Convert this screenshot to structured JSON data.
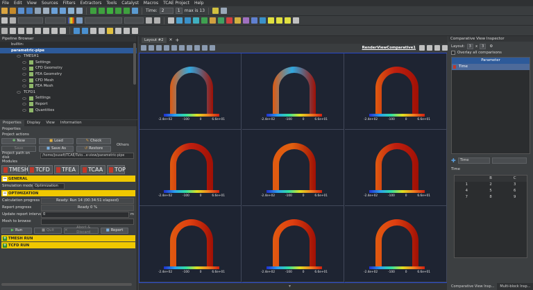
{
  "menubar": [
    "File",
    "Edit",
    "View",
    "Sources",
    "Filters",
    "Extractors",
    "Tools",
    "Catalyst",
    "Macros",
    "TCAE Project",
    "Help"
  ],
  "time_toolbar": {
    "time_label": "Time:",
    "time_value": "2",
    "step": "1",
    "max_label": "max is 13"
  },
  "pipeline_browser": {
    "title": "Pipeline Browser",
    "items": [
      {
        "label": "builtin:",
        "level": 0
      },
      {
        "label": "parametric-pipe",
        "level": 0,
        "selected": true
      },
      {
        "label": "TMESH1",
        "level": 1
      },
      {
        "label": "Settings",
        "level": 2
      },
      {
        "label": "CFD Geometry",
        "level": 2
      },
      {
        "label": "FEA Geometry",
        "level": 2
      },
      {
        "label": "CFD Mesh",
        "level": 2
      },
      {
        "label": "FEA Mesh",
        "level": 2
      },
      {
        "label": "TCFD1",
        "level": 1
      },
      {
        "label": "Settings",
        "level": 2
      },
      {
        "label": "Report",
        "level": 2
      },
      {
        "label": "Quantities",
        "level": 2
      }
    ]
  },
  "properties_panel": {
    "tabs": [
      "Properties",
      "Display",
      "View",
      "Information"
    ],
    "title": "Properties",
    "project_actions_label": "Project actions",
    "buttons_row1": [
      "New",
      "Load",
      "Check"
    ],
    "buttons_row2": [
      "Save",
      "Save As",
      "Restore"
    ],
    "others_label": "Others",
    "project_path_label": "Project path on disk",
    "project_path_value": "/home/jousefi/TCAE/Tuto...e-view/parametric-pipe",
    "modules_label": "Modules",
    "modules": [
      "TMESH",
      "TCFD",
      "TFEA",
      "TCAA",
      "TOP"
    ],
    "general_label": "GENERAL",
    "simulation_mode_label": "Simulation mode",
    "simulation_mode_value": "Optimization",
    "optimization_label": "OPTIMIZATION",
    "calc_progress_label": "Calculation progress",
    "calc_progress_value": "Ready: Run 14 (00:34:51 elapsed)",
    "report_progress_label": "Report progress",
    "report_progress_value": "Ready 0 %",
    "update_interval_label": "Update report interval",
    "update_interval_value": "0",
    "update_interval_unit": "m",
    "mesh_browse_label": "Mesh to browse",
    "run_buttons": [
      "Run",
      "Quit",
      "Abort & Discard",
      "Report"
    ],
    "tmesh_run_label": "TMESH RUN",
    "tcfd_run_label": "TCFD RUN"
  },
  "view": {
    "layout_tab": "Layout #2",
    "render_view_label": "RenderViewComparative1",
    "colorbar_ticks": [
      "-2.4e+02",
      "-100",
      "0",
      "6.6e+01"
    ],
    "cell_colors": [
      {
        "left": "#e05a10",
        "right": "#a01005",
        "top": "#30a8e0"
      },
      {
        "left": "#e05a10",
        "right": "#a01005",
        "top": "#30a8e0"
      },
      {
        "left": "#e05a10",
        "right": "#a01005",
        "top": "#c02010"
      },
      {
        "left": "#e05a10",
        "right": "#a01005",
        "top": "#c02010"
      },
      {
        "left": "#e05a10",
        "right": "#a01005",
        "top": "#e06010"
      },
      {
        "left": "#e05a10",
        "right": "#a01005",
        "top": "#c02010"
      },
      {
        "left": "#e05a10",
        "right": "#a01005",
        "top": "#e04010"
      },
      {
        "left": "#e05a10",
        "right": "#a01005",
        "top": "#e04010"
      },
      {
        "left": "#e05a10",
        "right": "#a01005",
        "top": "#e04010"
      }
    ]
  },
  "inspector": {
    "title": "Comparative View Inspector",
    "layout_label": "Layout:",
    "layout_rows": "3",
    "layout_x": "x",
    "layout_cols": "3",
    "overlay_label": "Overlay all comparisons",
    "param_header": "Parameter",
    "param_row": "Time",
    "time_select": "Time",
    "time_label": "Time",
    "table_headers": [
      "",
      "B",
      "C"
    ],
    "table_rows": [
      [
        "1",
        "2",
        "3"
      ],
      [
        "4",
        "5",
        "6"
      ],
      [
        "7",
        "8",
        "9"
      ]
    ],
    "bottom_tabs": [
      "Comparative View Insp...",
      "Multi-block Insp..."
    ]
  }
}
